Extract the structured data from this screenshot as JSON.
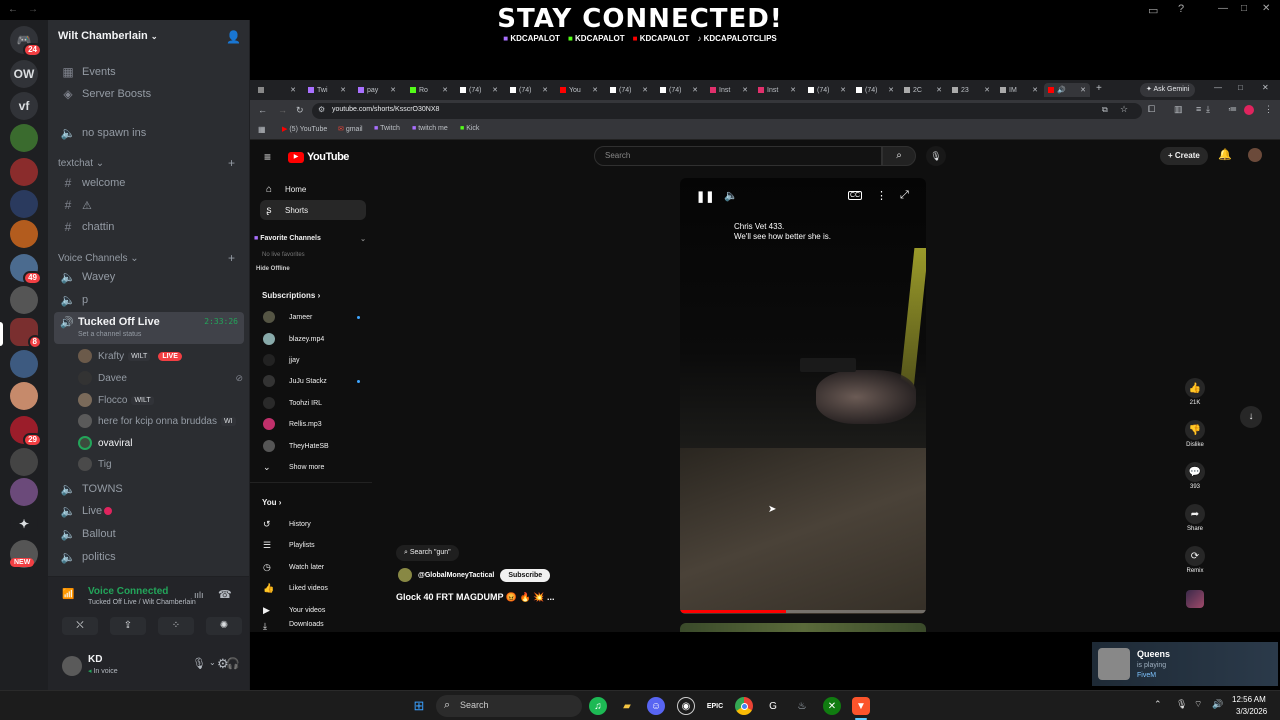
{
  "overlay": {
    "headline": "STAY CONNECTED!",
    "socials": [
      "KDCAPALOT",
      "KDCAPALOT",
      "KDCAPALOT",
      "KDCAPALOTCLIPS"
    ]
  },
  "discord": {
    "server_name": "Wilt Chamberlain",
    "rail": {
      "top_badge": "24",
      "ow": "OW",
      "vf": "vf",
      "badge_49": "49",
      "badge_8": "8",
      "badge_29": "29",
      "new": "NEW"
    },
    "top_items": [
      {
        "icon": "calendar-icon",
        "label": "Events"
      },
      {
        "icon": "boost-icon",
        "label": "Server Boosts"
      },
      {
        "icon": "speaker-icon",
        "label": "no spawn ins"
      }
    ],
    "textchat_category": "textchat",
    "text_channels": [
      "welcome",
      "⚠",
      "chattin"
    ],
    "voice_category": "Voice Channels",
    "voice_channels_top": [
      "Wavey",
      "p"
    ],
    "active_channel": {
      "name": "Tucked Off Live",
      "timer": "2:33:26",
      "status_hint": "Set a channel status"
    },
    "voice_members": [
      {
        "name": "Krafty",
        "tag": "WILT",
        "live": "LIVE"
      },
      {
        "name": "Davee"
      },
      {
        "name": "Flocco",
        "tag": "WILT"
      },
      {
        "name": "here for kcip onna bruddas",
        "tag": "WI"
      },
      {
        "name": "ovaviral"
      },
      {
        "name": "Tig"
      }
    ],
    "voice_channels_bottom": [
      "TOWNS",
      "Live",
      "Ballout",
      "politics"
    ],
    "voice_connected": {
      "title": "Voice Connected",
      "subtitle": "Tucked Off Live / Wilt Chamberlain"
    },
    "user": {
      "name": "KD",
      "status": "In voice"
    }
  },
  "browser": {
    "tabs": [
      "",
      "Twi",
      "pay",
      "Ro",
      "(74)",
      "(74)",
      "You",
      "(74)",
      "(74)",
      "Inst",
      "Inst",
      "(74)",
      "(74)",
      "2C",
      "23",
      "IM",
      ""
    ],
    "ask_gemini": "Ask Gemini",
    "url": "youtube.com/shorts/KsscrO30NX8",
    "bookmarks": [
      "(5) YouTube",
      "gmail",
      "Twitch",
      "twitch me",
      "Kick"
    ]
  },
  "youtube": {
    "logo": "YouTube",
    "search_placeholder": "Search",
    "create": "Create",
    "nav": [
      {
        "label": "Home"
      },
      {
        "label": "Shorts"
      }
    ],
    "favorite_channels": "Favorite Channels",
    "no_live_favorites": "No live favorites",
    "hide_offline": "Hide Offline",
    "subscriptions": "Subscriptions",
    "subs": [
      "Jameer",
      "blazey.mp4",
      "jjay",
      "JuJu Stackz",
      "Toohzi IRL",
      "Rellis.mp3",
      "TheyHateSB"
    ],
    "show_more": "Show more",
    "you": "You",
    "you_items": [
      "History",
      "Playlists",
      "Watch later",
      "Liked videos",
      "Your videos",
      "Downloads"
    ],
    "video": {
      "caption_line1": "Chris Vet 433.",
      "caption_line2": "We'll see how better she is.",
      "search_chip": "Search \"gun\"",
      "channel": "@GlobalMoneyTactical",
      "subscribe": "Subscribe",
      "title": "Glock 40 FRT MAGDUMP 😡 🔥 💥 ...",
      "progress": 0.43
    },
    "actions": [
      {
        "icon": "thumbs-up-icon",
        "label": "21K"
      },
      {
        "icon": "thumbs-down-icon",
        "label": "Dislike"
      },
      {
        "icon": "comment-icon",
        "label": "393"
      },
      {
        "icon": "share-icon",
        "label": "Share"
      },
      {
        "icon": "remix-icon",
        "label": "Remix"
      }
    ]
  },
  "notification": {
    "name": "Queens",
    "line2": "is playing",
    "line3": "FiveM"
  },
  "taskbar": {
    "search": "Search",
    "time": "12:56 AM",
    "date": "3/3/2026"
  }
}
